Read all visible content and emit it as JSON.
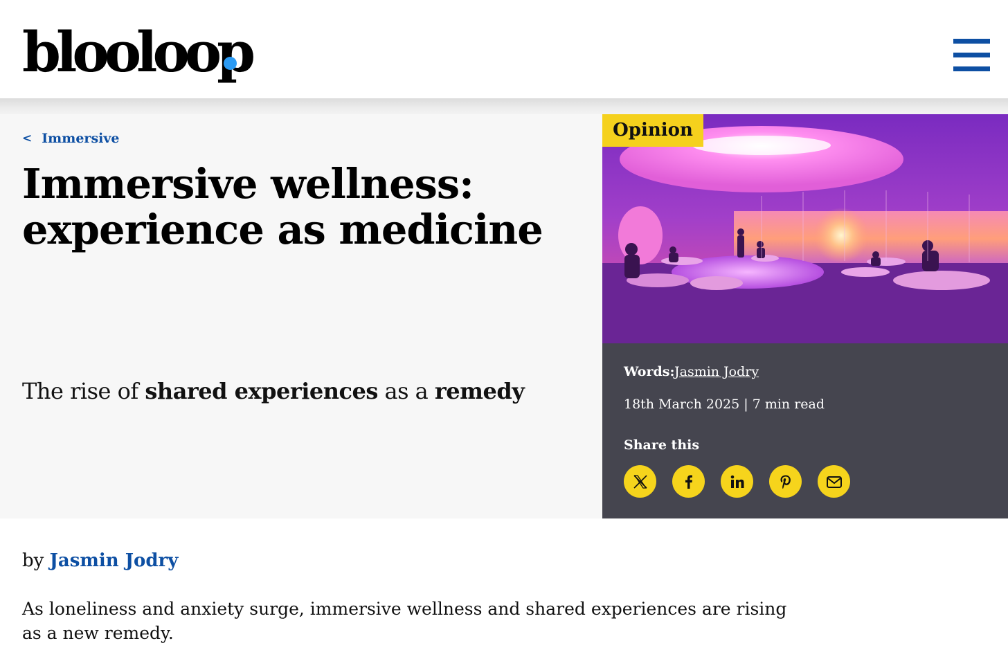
{
  "header": {
    "logo_text": "blooloop",
    "menu_icon": "hamburger-menu-icon"
  },
  "breadcrumb": {
    "chevron": "<",
    "label": "Immersive"
  },
  "article": {
    "headline_line1": "Immersive wellness:",
    "headline_line2": "experience as medicine",
    "standfirst": {
      "part1": "The rise of ",
      "bold1": "shared experiences",
      "part2": " as a ",
      "bold2": "remedy"
    },
    "category": "Opinion",
    "hero_image_icon": "wellness-lounge-photo",
    "words_label": "Words:",
    "author": "Jasmin Jodry",
    "date_read": "18th March 2025 | 7 min read",
    "share_label": "Share this",
    "share_icons": [
      "x-icon",
      "facebook-icon",
      "linkedin-icon",
      "pinterest-icon",
      "email-icon"
    ],
    "byline_prefix": "by",
    "byline_author": "Jasmin Jodry",
    "intro": "As loneliness and anxiety surge, immersive wellness and shared experiences are rising as a new remedy."
  },
  "colors": {
    "brand_blue": "#0d4fa3",
    "logo_dot": "#2b9bf4",
    "badge_yellow": "#f5d11d",
    "panel_dark": "#45454f",
    "share_yellow": "#f6d41c"
  }
}
